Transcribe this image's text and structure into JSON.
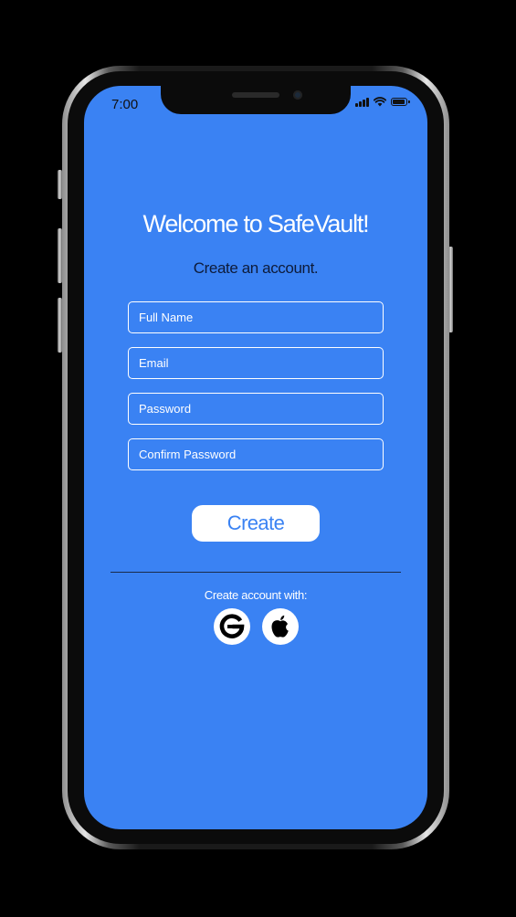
{
  "status_bar": {
    "time": "7:00",
    "icons": [
      "cellular-signal-icon",
      "wifi-icon",
      "battery-icon"
    ]
  },
  "signup": {
    "title": "Welcome to SafeVault!",
    "subtitle": "Create an account.",
    "fields": {
      "full_name_placeholder": "Full Name",
      "email_placeholder": "Email",
      "password_placeholder": "Password",
      "confirm_password_placeholder": "Confirm Password"
    },
    "create_label": "Create",
    "social_label": "Create account with:",
    "social_icons": [
      "google-icon",
      "apple-icon"
    ]
  },
  "colors": {
    "screen_background": "#3a82f3",
    "button_text": "#3a82f3",
    "subtitle_text": "#0d1b3a",
    "frame_background": "#000000"
  }
}
